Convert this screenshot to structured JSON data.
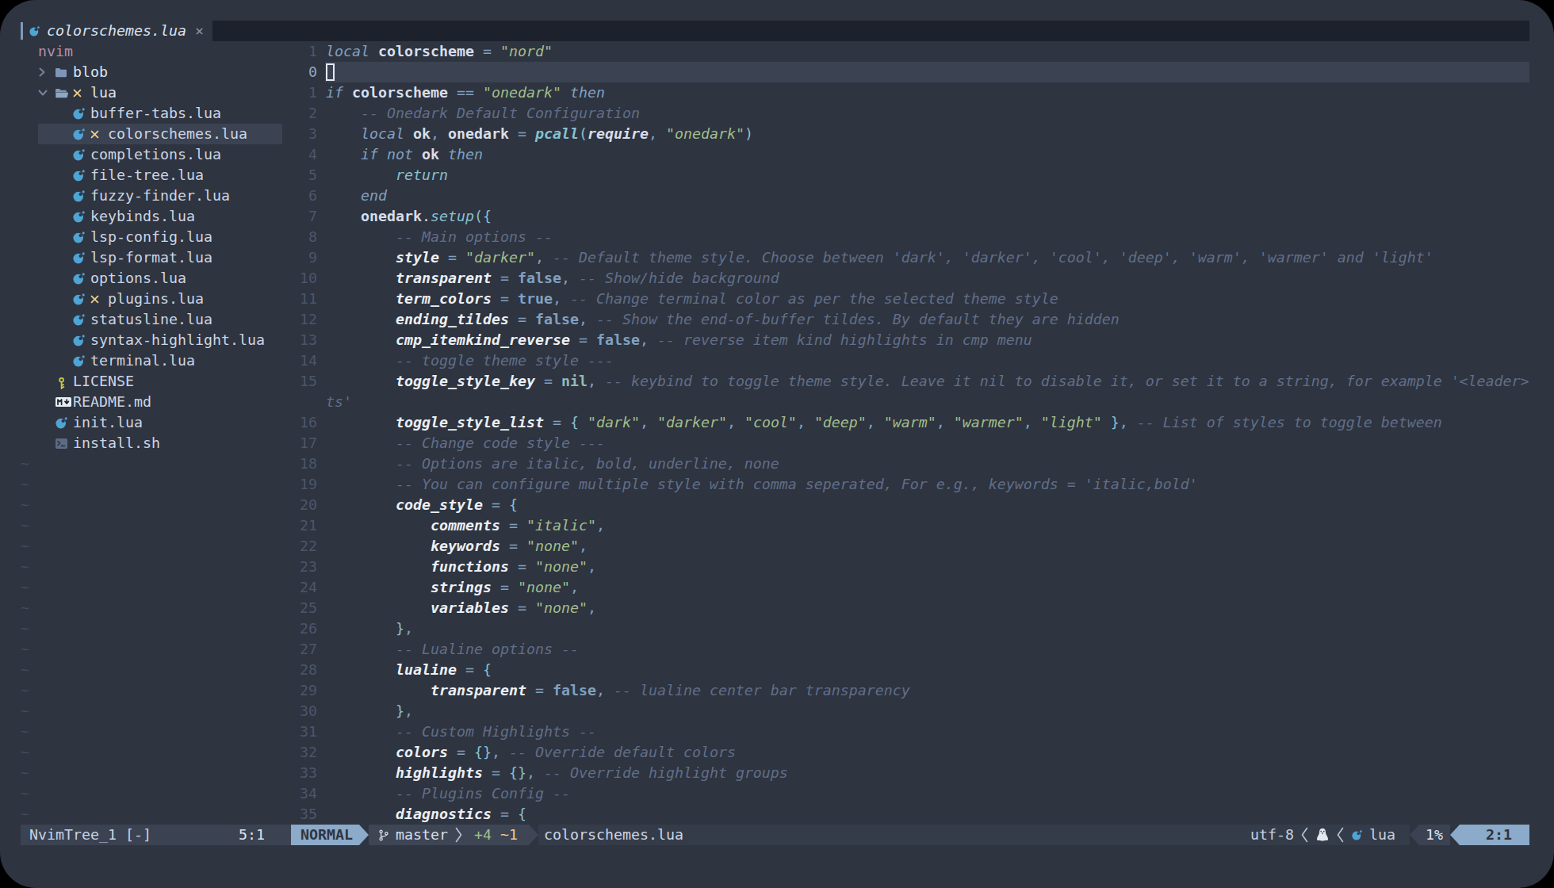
{
  "colors": {
    "background": "#2e3440",
    "tabline_fill": "#1d212b",
    "cursor_line": "#3b4252",
    "accent_blue": "#8caac9",
    "keyword_blue": "#81a1c1",
    "string_green": "#a3be8c",
    "comment_gray": "#616e88",
    "git_mark_yellow": "#ebcb8b",
    "lua_icon_blue": "#4fa4d4"
  },
  "tab_bar": {
    "tabs": [
      {
        "label": "colorschemes.lua",
        "close_glyph": "×",
        "icon": "lua-icon",
        "active": true
      }
    ]
  },
  "file_tree": {
    "root": "nvim",
    "items": [
      {
        "label": "nvim",
        "kind": "root",
        "label_col": 2
      },
      {
        "label": "blob",
        "kind": "dir",
        "arrow": "right",
        "icon": "folder",
        "arrow_col": 2,
        "icon_col": 4,
        "label_col": 6
      },
      {
        "label": "lua",
        "kind": "dir",
        "arrow": "down",
        "icon": "folder-open",
        "git": true,
        "arrow_col": 2,
        "icon_col": 4,
        "git_col": 6,
        "label_col": 8
      },
      {
        "label": "buffer-tabs.lua",
        "kind": "file",
        "icon": "lua",
        "icon_col": 6,
        "label_col": 8
      },
      {
        "label": "colorschemes.lua",
        "kind": "file",
        "icon": "lua",
        "git": true,
        "icon_col": 6,
        "git_col": 8,
        "label_col": 10,
        "selected": true
      },
      {
        "label": "completions.lua",
        "kind": "file",
        "icon": "lua",
        "icon_col": 6,
        "label_col": 8
      },
      {
        "label": "file-tree.lua",
        "kind": "file",
        "icon": "lua",
        "icon_col": 6,
        "label_col": 8
      },
      {
        "label": "fuzzy-finder.lua",
        "kind": "file",
        "icon": "lua",
        "icon_col": 6,
        "label_col": 8
      },
      {
        "label": "keybinds.lua",
        "kind": "file",
        "icon": "lua",
        "icon_col": 6,
        "label_col": 8
      },
      {
        "label": "lsp-config.lua",
        "kind": "file",
        "icon": "lua",
        "icon_col": 6,
        "label_col": 8
      },
      {
        "label": "lsp-format.lua",
        "kind": "file",
        "icon": "lua",
        "icon_col": 6,
        "label_col": 8
      },
      {
        "label": "options.lua",
        "kind": "file",
        "icon": "lua",
        "icon_col": 6,
        "label_col": 8
      },
      {
        "label": "plugins.lua",
        "kind": "file",
        "icon": "lua",
        "git": true,
        "icon_col": 6,
        "git_col": 8,
        "label_col": 10
      },
      {
        "label": "statusline.lua",
        "kind": "file",
        "icon": "lua",
        "icon_col": 6,
        "label_col": 8
      },
      {
        "label": "syntax-highlight.lua",
        "kind": "file",
        "icon": "lua",
        "icon_col": 6,
        "label_col": 8
      },
      {
        "label": "terminal.lua",
        "kind": "file",
        "icon": "lua",
        "icon_col": 6,
        "label_col": 8
      },
      {
        "label": "LICENSE",
        "kind": "file",
        "icon": "key",
        "icon_col": 4,
        "label_col": 6
      },
      {
        "label": "README.md",
        "kind": "file",
        "icon": "markdown",
        "icon_col": 4,
        "label_col": 6
      },
      {
        "label": "init.lua",
        "kind": "file",
        "icon": "lua",
        "icon_col": 4,
        "label_col": 6
      },
      {
        "label": "install.sh",
        "kind": "file",
        "icon": "shell",
        "icon_col": 4,
        "label_col": 6
      }
    ],
    "empty_line_glyph": "~",
    "empty_line_count": 18
  },
  "editor": {
    "cursor": {
      "row": 2,
      "col": 35
    },
    "lines": [
      {
        "num": "1",
        "seg": [
          [
            "k",
            "local "
          ],
          [
            "v",
            "colorscheme"
          ],
          [
            "o",
            " = "
          ],
          [
            "s",
            "\"nord\""
          ]
        ]
      },
      {
        "num": "0",
        "cursorline": true,
        "seg": []
      },
      {
        "num": "1",
        "seg": [
          [
            "k",
            "if "
          ],
          [
            "v",
            "colorscheme"
          ],
          [
            "o",
            " == "
          ],
          [
            "s",
            "\"onedark\""
          ],
          [
            "k",
            " then"
          ]
        ]
      },
      {
        "num": "2",
        "seg": [
          [
            "c",
            "    -- Onedark Default Configuration"
          ]
        ]
      },
      {
        "num": "3",
        "seg": [
          [
            "k",
            "    local "
          ],
          [
            "v",
            "ok"
          ],
          [
            "pb",
            ","
          ],
          [
            "t",
            " "
          ],
          [
            "v",
            "onedark"
          ],
          [
            "o",
            " = "
          ],
          [
            "fn",
            "pcall"
          ],
          [
            "p",
            "("
          ],
          [
            "fnw",
            "require"
          ],
          [
            "pb",
            ","
          ],
          [
            "t",
            " "
          ],
          [
            "s",
            "\"onedark\""
          ],
          [
            "p",
            ")"
          ]
        ]
      },
      {
        "num": "4",
        "seg": [
          [
            "k",
            "    if not "
          ],
          [
            "v",
            "ok"
          ],
          [
            "k",
            " then"
          ]
        ]
      },
      {
        "num": "5",
        "seg": [
          [
            "kr",
            "        return"
          ]
        ]
      },
      {
        "num": "6",
        "seg": [
          [
            "k",
            "    end"
          ]
        ]
      },
      {
        "num": "7",
        "seg": [
          [
            "t",
            "    "
          ],
          [
            "v",
            "onedark"
          ],
          [
            "t",
            "."
          ],
          [
            "m",
            "setup"
          ],
          [
            "p",
            "({"
          ]
        ]
      },
      {
        "num": "8",
        "seg": [
          [
            "c",
            "        -- Main options --"
          ]
        ]
      },
      {
        "num": "9",
        "seg": [
          [
            "f",
            "        style"
          ],
          [
            "o",
            " = "
          ],
          [
            "s",
            "\"darker\""
          ],
          [
            "pb",
            ","
          ],
          [
            "c",
            " -- Default theme style. Choose between 'dark', 'darker', 'cool', 'deep', 'warm', 'warmer' and 'light'"
          ]
        ]
      },
      {
        "num": "10",
        "seg": [
          [
            "f",
            "        transparent"
          ],
          [
            "o",
            " = "
          ],
          [
            "b",
            "false"
          ],
          [
            "pb",
            ","
          ],
          [
            "c",
            " -- Show/hide background"
          ]
        ]
      },
      {
        "num": "11",
        "seg": [
          [
            "f",
            "        term_colors"
          ],
          [
            "o",
            " = "
          ],
          [
            "b",
            "true"
          ],
          [
            "pb",
            ","
          ],
          [
            "c",
            " -- Change terminal color as per the selected theme style"
          ]
        ]
      },
      {
        "num": "12",
        "seg": [
          [
            "f",
            "        ending_tildes"
          ],
          [
            "o",
            " = "
          ],
          [
            "b",
            "false"
          ],
          [
            "pb",
            ","
          ],
          [
            "c",
            " -- Show the end-of-buffer tildes. By default they are hidden"
          ]
        ]
      },
      {
        "num": "13",
        "seg": [
          [
            "f",
            "        cmp_itemkind_reverse"
          ],
          [
            "o",
            " = "
          ],
          [
            "b",
            "false"
          ],
          [
            "pb",
            ","
          ],
          [
            "c",
            " -- reverse item kind highlights in cmp menu"
          ]
        ]
      },
      {
        "num": "14",
        "seg": [
          [
            "c",
            "        -- toggle theme style ---"
          ]
        ]
      },
      {
        "num": "15",
        "seg": [
          [
            "f",
            "        toggle_style_key"
          ],
          [
            "o",
            " = "
          ],
          [
            "n",
            "nil"
          ],
          [
            "pb",
            ","
          ],
          [
            "c",
            " -- keybind to toggle theme style. Leave it nil to disable it, or set it to a string, for example '<leader>"
          ]
        ]
      },
      {
        "num": null,
        "seg": [
          [
            "c",
            "ts'"
          ]
        ]
      },
      {
        "num": "16",
        "seg": [
          [
            "f",
            "        toggle_style_list"
          ],
          [
            "o",
            " = "
          ],
          [
            "p",
            "{"
          ],
          [
            "t",
            " "
          ],
          [
            "s",
            "\"dark\""
          ],
          [
            "pb",
            ","
          ],
          [
            "t",
            " "
          ],
          [
            "s",
            "\"darker\""
          ],
          [
            "pb",
            ","
          ],
          [
            "t",
            " "
          ],
          [
            "s",
            "\"cool\""
          ],
          [
            "pb",
            ","
          ],
          [
            "t",
            " "
          ],
          [
            "s",
            "\"deep\""
          ],
          [
            "pb",
            ","
          ],
          [
            "t",
            " "
          ],
          [
            "s",
            "\"warm\""
          ],
          [
            "pb",
            ","
          ],
          [
            "t",
            " "
          ],
          [
            "s",
            "\"warmer\""
          ],
          [
            "pb",
            ","
          ],
          [
            "t",
            " "
          ],
          [
            "s",
            "\"light\""
          ],
          [
            "t",
            " "
          ],
          [
            "p",
            "}"
          ],
          [
            "pb",
            ","
          ],
          [
            "c",
            " -- List of styles to toggle between"
          ]
        ]
      },
      {
        "num": "17",
        "seg": [
          [
            "c",
            "        -- Change code style ---"
          ]
        ]
      },
      {
        "num": "18",
        "seg": [
          [
            "c",
            "        -- Options are italic, bold, underline, none"
          ]
        ]
      },
      {
        "num": "19",
        "seg": [
          [
            "c",
            "        -- You can configure multiple style with comma seperated, For e.g., keywords = 'italic,bold'"
          ]
        ]
      },
      {
        "num": "20",
        "seg": [
          [
            "f",
            "        code_style"
          ],
          [
            "o",
            " = "
          ],
          [
            "p",
            "{"
          ]
        ]
      },
      {
        "num": "21",
        "seg": [
          [
            "f",
            "            comments"
          ],
          [
            "o",
            " = "
          ],
          [
            "s",
            "\"italic\""
          ],
          [
            "pb",
            ","
          ]
        ]
      },
      {
        "num": "22",
        "seg": [
          [
            "f",
            "            keywords"
          ],
          [
            "o",
            " = "
          ],
          [
            "s",
            "\"none\""
          ],
          [
            "pb",
            ","
          ]
        ]
      },
      {
        "num": "23",
        "seg": [
          [
            "f",
            "            functions"
          ],
          [
            "o",
            " = "
          ],
          [
            "s",
            "\"none\""
          ],
          [
            "pb",
            ","
          ]
        ]
      },
      {
        "num": "24",
        "seg": [
          [
            "f",
            "            strings"
          ],
          [
            "o",
            " = "
          ],
          [
            "s",
            "\"none\""
          ],
          [
            "pb",
            ","
          ]
        ]
      },
      {
        "num": "25",
        "seg": [
          [
            "f",
            "            variables"
          ],
          [
            "o",
            " = "
          ],
          [
            "s",
            "\"none\""
          ],
          [
            "pb",
            ","
          ]
        ]
      },
      {
        "num": "26",
        "seg": [
          [
            "p",
            "        }"
          ],
          [
            "pb",
            ","
          ]
        ]
      },
      {
        "num": "27",
        "seg": [
          [
            "c",
            "        -- Lualine options --"
          ]
        ]
      },
      {
        "num": "28",
        "seg": [
          [
            "f",
            "        lualine"
          ],
          [
            "o",
            " = "
          ],
          [
            "p",
            "{"
          ]
        ]
      },
      {
        "num": "29",
        "seg": [
          [
            "f",
            "            transparent"
          ],
          [
            "o",
            " = "
          ],
          [
            "b",
            "false"
          ],
          [
            "pb",
            ","
          ],
          [
            "c",
            " -- lualine center bar transparency"
          ]
        ]
      },
      {
        "num": "30",
        "seg": [
          [
            "p",
            "        }"
          ],
          [
            "pb",
            ","
          ]
        ]
      },
      {
        "num": "31",
        "seg": [
          [
            "c",
            "        -- Custom Highlights --"
          ]
        ]
      },
      {
        "num": "32",
        "seg": [
          [
            "f",
            "        colors"
          ],
          [
            "o",
            " = "
          ],
          [
            "p",
            "{}"
          ],
          [
            "pb",
            ","
          ],
          [
            "c",
            " -- Override default colors"
          ]
        ]
      },
      {
        "num": "33",
        "seg": [
          [
            "f",
            "        highlights"
          ],
          [
            "o",
            " = "
          ],
          [
            "p",
            "{}"
          ],
          [
            "pb",
            ","
          ],
          [
            "c",
            " -- Override highlight groups"
          ]
        ]
      },
      {
        "num": "34",
        "seg": [
          [
            "c",
            "        -- Plugins Config --"
          ]
        ]
      },
      {
        "num": "35",
        "seg": [
          [
            "f",
            "        diagnostics"
          ],
          [
            "o",
            " = "
          ],
          [
            "p",
            "{"
          ]
        ]
      }
    ]
  },
  "statusline": {
    "tree_window": {
      "title": "NvimTree_1 [-]",
      "location": "5:1"
    },
    "mode": "NORMAL",
    "git_branch": "master",
    "diff_added": "+4",
    "diff_modified": "~1",
    "filename": "colorschemes.lua",
    "encoding": "utf-8",
    "os_icon": "linux-penguin-icon",
    "filetype": "lua",
    "progress": "1%",
    "location": "2:1"
  }
}
